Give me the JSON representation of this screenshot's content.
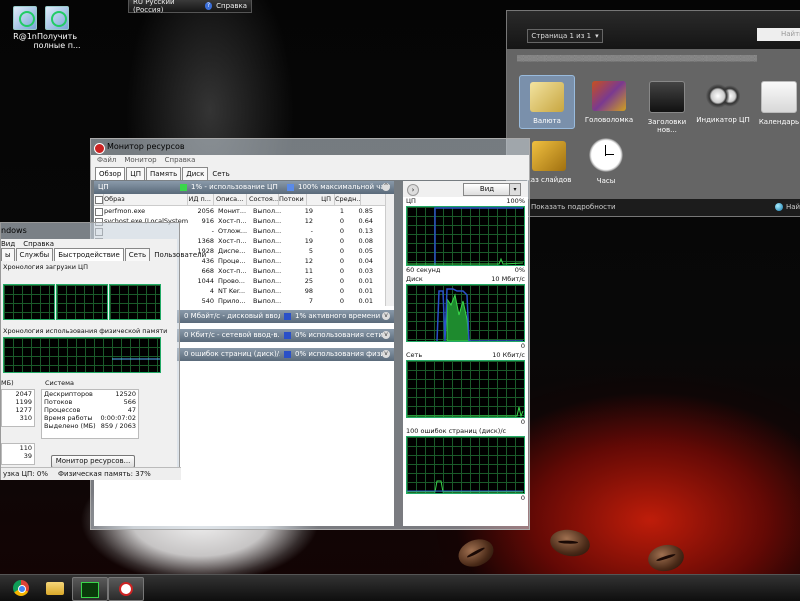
{
  "desktop": {
    "icons": [
      {
        "label": "R@1n"
      },
      {
        "label": "Получить полные п..."
      }
    ]
  },
  "langbar": {
    "language": "RU Русский (Россия)",
    "help": "Справка"
  },
  "gadgets": {
    "page": "Страница 1 из 1",
    "search_placeholder": "Найти",
    "items": [
      {
        "label": "Валюта"
      },
      {
        "label": "Головоломка"
      },
      {
        "label": "Заголовки нов..."
      },
      {
        "label": "Индикатор ЦП"
      },
      {
        "label": "Календарь"
      },
      {
        "label": "каз слайдов"
      },
      {
        "label": "Часы"
      }
    ],
    "details_link": "Показать подробности",
    "online_link": "Найти"
  },
  "resource_monitor": {
    "title": "Монитор ресурсов",
    "menu": [
      "Файл",
      "Монитор",
      "Справка"
    ],
    "tabs": [
      "Обзор",
      "ЦП",
      "Память",
      "Диск",
      "Сеть"
    ],
    "cpu_section": {
      "title": "ЦП",
      "usage": "1% - использование ЦП",
      "max_freq": "100% максимальной част..."
    },
    "columns": [
      "Образ",
      "ИД п...",
      "Описа...",
      "Состоя...",
      "Потоки",
      "ЦП",
      "Средн..."
    ],
    "rows": [
      [
        "perfmon.exe",
        "2056",
        "Монит...",
        "Выпол...",
        "19",
        "1",
        "0.85"
      ],
      [
        "svchost.exe (LocalSystemNet...",
        "916",
        "Хост-п...",
        "Выпол...",
        "12",
        "0",
        "0.64"
      ],
      [
        "",
        "-",
        "Отлож...",
        "Выпол...",
        "-",
        "0",
        "0.13"
      ],
      [
        "",
        "1368",
        "Хост-п...",
        "Выпол...",
        "19",
        "0",
        "0.08"
      ],
      [
        "",
        "1928",
        "Диспе...",
        "Выпол...",
        "5",
        "0",
        "0.05"
      ],
      [
        "",
        "436",
        "Проце...",
        "Выпол...",
        "12",
        "0",
        "0.04"
      ],
      [
        "",
        "668",
        "Хост-п...",
        "Выпол...",
        "11",
        "0",
        "0.03"
      ],
      [
        "",
        "1044",
        "Прово...",
        "Выпол...",
        "25",
        "0",
        "0.01"
      ],
      [
        "",
        "4",
        "NT Ker...",
        "Выпол...",
        "98",
        "0",
        "0.01"
      ],
      [
        "",
        "540",
        "Прило...",
        "Выпол...",
        "7",
        "0",
        "0.01"
      ]
    ],
    "disk_section": {
      "usage": "0 Мбайт/с - дисковый ввод-в...",
      "active": "1% активного времени (м..."
    },
    "network_section": {
      "usage": "0 Кбит/с - сетевой ввод-в...",
      "util": "0% использования сети (%)"
    },
    "memory_section": {
      "usage": "0 ошибок страниц (диск)/...",
      "util": "0% использования физическ..."
    },
    "right_panel": {
      "view_button": "Вид",
      "graphs": [
        {
          "label": "ЦП",
          "max": "100%",
          "time": "60 секунд",
          "min": "0%"
        },
        {
          "label": "Диск",
          "max": "10 Мбит/с",
          "min": "0"
        },
        {
          "label": "Сеть",
          "max": "10 Кбит/с",
          "min": "0"
        },
        {
          "label": "100 ошибок страниц (диск)/с",
          "min": "0"
        }
      ]
    }
  },
  "task_manager": {
    "title": "ndows",
    "menu": [
      "Вид",
      "Справка"
    ],
    "tabs": [
      "ы",
      "Службы",
      "Быстродействие",
      "Сеть",
      "Пользователи"
    ],
    "cpu_history": "Хронология загрузки ЦП",
    "memory_history": "Хронология использования физической памяти",
    "memory_label": "МБ)",
    "memory_values": [
      "2047",
      "1199",
      "1277",
      "310"
    ],
    "kernel_values": [
      "110",
      "39"
    ],
    "system": {
      "title": "Система",
      "rows": [
        {
          "label": "Дескрипторов",
          "value": "12520"
        },
        {
          "label": "Потоков",
          "value": "566"
        },
        {
          "label": "Процессов",
          "value": "47"
        },
        {
          "label": "Время работы",
          "value": "0:00:07:02"
        },
        {
          "label": "Выделено (МБ)",
          "value": "859 / 2063"
        }
      ]
    },
    "resource_monitor_button": "Монитор ресурсов...",
    "status_cpu": "узка ЦП: 0%",
    "status_memory": "Физическая память: 37%"
  },
  "colors": {
    "graph_line": "#3ad64a",
    "graph_fill": "#1e8a2e",
    "accent_blue": "#2a50c8",
    "section_head": "#6a7a8a"
  }
}
